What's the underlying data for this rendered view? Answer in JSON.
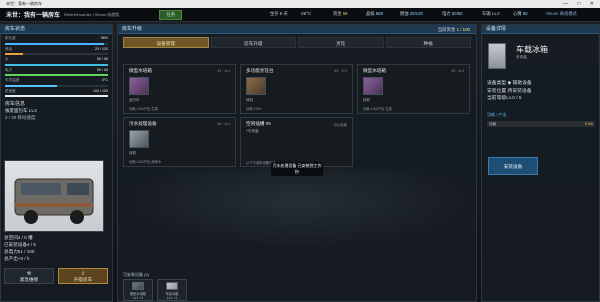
{
  "window": {
    "title": "末世：我有一辆房车",
    "controls": "— □ ✕"
  },
  "topbar": {
    "game_title": "末世：我有一辆房车",
    "user": "RebirthHoarder | Steam 成就版",
    "mission": "任务",
    "day": "生存 8 天",
    "temp": "-26°C",
    "gold_label": "资金",
    "gold": "58",
    "parts_label": "晶核",
    "parts": "889",
    "fuel_label": "燃油",
    "fuel": "20/120",
    "food_label": "电力",
    "food": "50/50",
    "car_label": "车辆",
    "car": "Lv.2",
    "mood_label": "心情",
    "mood": "80",
    "steam": "Steam 离线模式"
  },
  "left": {
    "header": "房车状态",
    "bars": [
      {
        "label": "耐久度",
        "value": "96%",
        "pct": 96,
        "color": "#48b6ff"
      },
      {
        "label": "燃油",
        "value": "20 / 120",
        "pct": 17,
        "color": "#e3a53c"
      },
      {
        "label": "水",
        "value": "50 / 50",
        "pct": 100,
        "color": "#3fc2e8"
      },
      {
        "label": "电力",
        "value": "50 / 50",
        "pct": 100,
        "color": "#63d35b"
      },
      {
        "label": "车内温度",
        "value": "0°C",
        "pct": 50,
        "color": "#58c1ff"
      },
      {
        "label": "舒适度",
        "value": "100 / 100",
        "pct": 100,
        "color": "#e9edf0"
      }
    ],
    "info_title": "房车信息",
    "info_model": "报废面包车 Lv.2",
    "info_speed": "2 / 20 移动速度",
    "slot_total": "总空间4 / 5 槽",
    "slot_used": "已安装设备4 / 5",
    "power_total": "总电力51 / 100",
    "power_use": "总产出+0 / h",
    "btn_repair": "紧急维修",
    "btn_upgrade": "升级房车"
  },
  "middle": {
    "header": "房车升级",
    "budget_label": "当前资金",
    "budget_value": "1 / 100",
    "tabs": [
      "设备管理",
      "房车升级",
      "烹饪",
      "种植"
    ],
    "cards": [
      {
        "title": "微型水培箱",
        "slot": "#1 · 1×1",
        "state": "运行中",
        "effect": "功耗 1.6/h产出 生菜"
      },
      {
        "title": "多功能烹饪台",
        "slot": "#2 · 1×1",
        "state": "待机",
        "effect": "功耗 0.5/h"
      },
      {
        "title": "微型水培箱",
        "slot": "#3 · 1×1",
        "state": "待机",
        "effect": "功耗 1.6/h产出 生菜"
      },
      {
        "title": "污水处理设备",
        "slot": "#4 · 1×1",
        "state": "待机",
        "effect": "功耗 0.8/h产出 纯净水"
      },
      {
        "title": "空闲插槽 #5",
        "slot": "可以安装",
        "state": "+可安装",
        "effect": "从下方选择设备安装"
      }
    ],
    "tooltip": "污水处理设备 已安装到工作台!",
    "installed_label": "可安装设备 (2)",
    "chips": [
      {
        "name": "微型水培箱",
        "count": "Lv.1 ×1"
      },
      {
        "name": "车载冰箱",
        "count": "Lv.1 ×1"
      }
    ]
  },
  "right": {
    "header": "设备详情",
    "title": "车载冰箱",
    "subtitle": "未安装",
    "lines": [
      "设备类型 ◆ 辅助设备",
      "安装位置 待安装设备",
      "当前等级Lv.0 / 5"
    ],
    "tag": "功耗 / 产出",
    "prog_label": "功耗",
    "prog_value": "0.0/h",
    "button": "安装设备"
  }
}
